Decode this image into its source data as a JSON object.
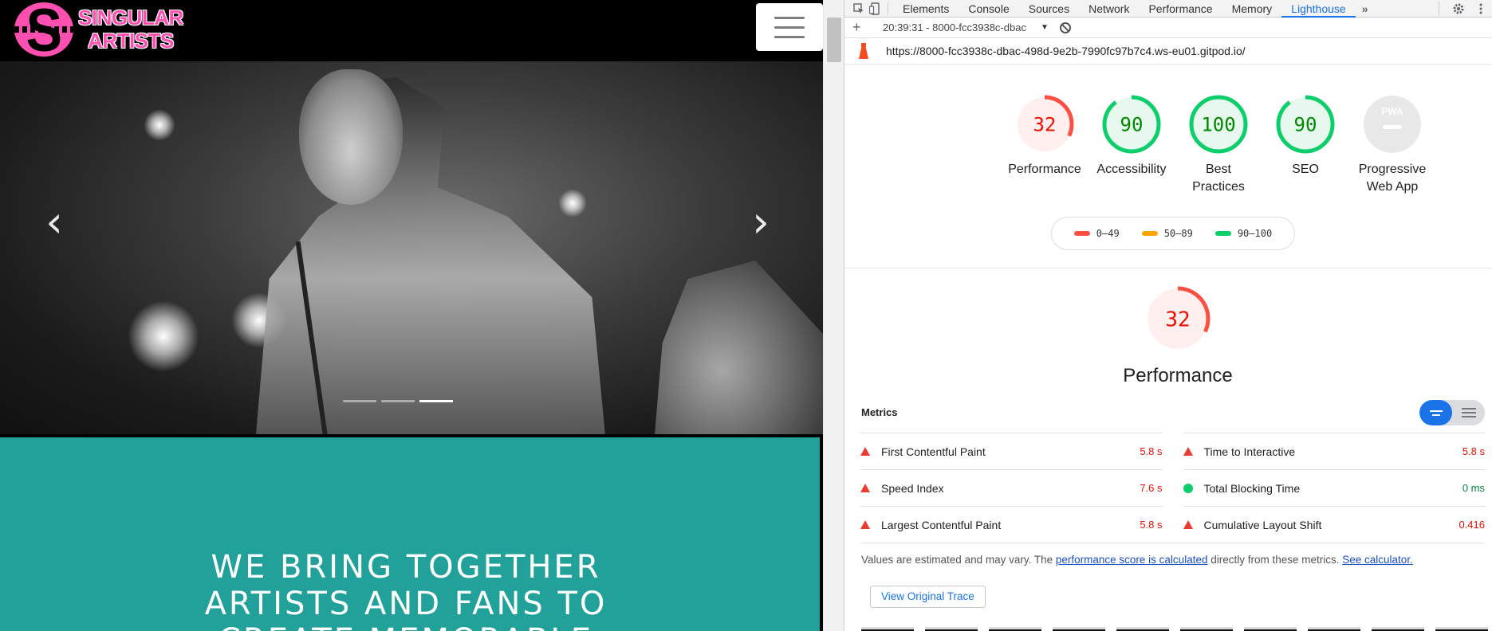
{
  "site": {
    "logo_text_line1": "SINGULAR",
    "logo_text_line2": "ARTISTS",
    "tagline_lines": [
      "WE BRING TOGETHER",
      "ARTISTS AND FANS TO",
      "CREATE MEMORABLE"
    ],
    "carousel_prev": "‹",
    "carousel_next": "›",
    "carousel_slides": 3,
    "carousel_active_slide": 3
  },
  "devtools": {
    "tabs": [
      "Elements",
      "Console",
      "Sources",
      "Network",
      "Performance",
      "Memory",
      "Lighthouse"
    ],
    "active_tab": "Lighthouse",
    "more_tabs": "»",
    "report_selector": "20:39:31 - 8000-fcc3938c-dbac",
    "url": "https://8000-fcc3938c-dbac-498d-9e2b-7990fc97b7c4.ws-eu01.gitpod.io/"
  },
  "categories": [
    {
      "score": "32",
      "label_line1": "Performance",
      "label_line2": "",
      "fraction": 0.32,
      "rating": "fail"
    },
    {
      "score": "90",
      "label_line1": "Accessibility",
      "label_line2": "",
      "fraction": 0.9,
      "rating": "pass"
    },
    {
      "score": "100",
      "label_line1": "Best",
      "label_line2": "Practices",
      "fraction": 1.0,
      "rating": "pass"
    },
    {
      "score": "90",
      "label_line1": "SEO",
      "label_line2": "",
      "fraction": 0.9,
      "rating": "pass"
    },
    {
      "score": "",
      "label_line1": "Progressive",
      "label_line2": "Web App",
      "fraction": 0,
      "rating": "pwa",
      "badge": "PWA"
    }
  ],
  "legend": [
    {
      "range": "0–49",
      "color": "#ff4e42"
    },
    {
      "range": "50–89",
      "color": "#ffa400"
    },
    {
      "range": "90–100",
      "color": "#0cce6b"
    }
  ],
  "performance": {
    "score": "32",
    "fraction": 0.32,
    "title": "Performance",
    "metrics_title": "Metrics",
    "metrics": [
      {
        "name": "First Contentful Paint",
        "value": "5.8 s",
        "status": "bad"
      },
      {
        "name": "Time to Interactive",
        "value": "5.8 s",
        "status": "bad"
      },
      {
        "name": "Speed Index",
        "value": "7.6 s",
        "status": "bad"
      },
      {
        "name": "Total Blocking Time",
        "value": "0 ms",
        "status": "good"
      },
      {
        "name": "Largest Contentful Paint",
        "value": "5.8 s",
        "status": "bad"
      },
      {
        "name": "Cumulative Layout Shift",
        "value": "0.416",
        "status": "bad"
      }
    ],
    "note_prefix": "Values are estimated and may vary. The ",
    "note_link1": "performance score is calculated",
    "note_middle": " directly from these metrics. ",
    "note_link2": "See calculator.",
    "trace_button": "View Original Trace"
  },
  "colors": {
    "fail": "#ff4e42",
    "fail_bg": "#fff0ef",
    "fail_text": "#eb0f00",
    "pass": "#0cce6b",
    "pass_bg": "#e7f9ef",
    "pass_text": "#008800",
    "pwa_bg": "#e8e8e8",
    "teal": "#21a19a",
    "brand_pink": "#ff4fb0"
  },
  "icons": {
    "inspect": "inspect-element-icon",
    "device": "device-toolbar-icon",
    "settings": "gear-icon",
    "more": "vertical-dots-icon",
    "new_report": "plus-icon",
    "clear": "clear-icon",
    "lighthouse": "lighthouse-logo-icon"
  }
}
